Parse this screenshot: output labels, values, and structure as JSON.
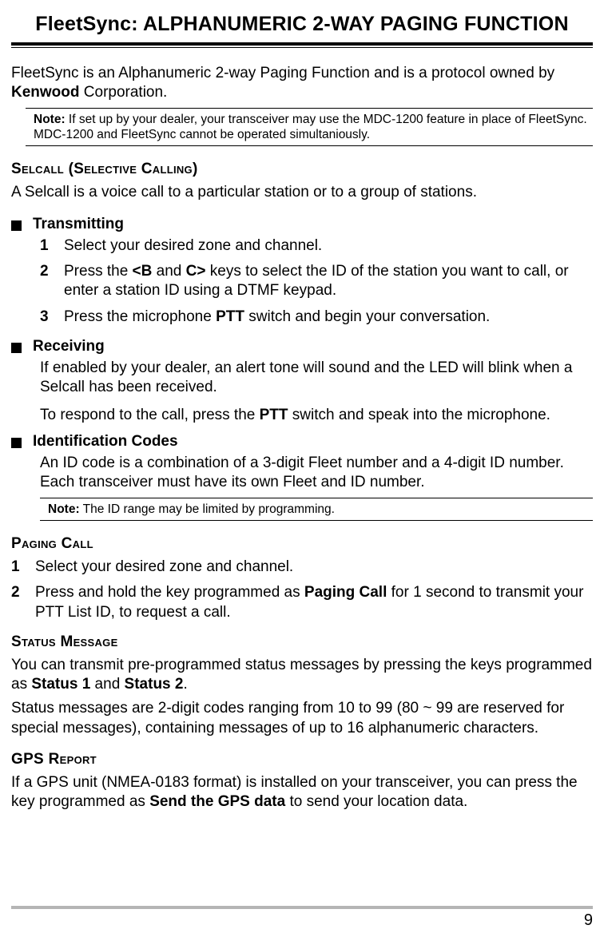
{
  "chapterTitle": "FleetSync: ALPHANUMERIC 2-WAY PAGING FUNCTION",
  "intro": {
    "pre": "FleetSync is an Alphanumeric 2-way Paging Function and is a protocol owned by ",
    "bold": "Kenwood",
    "post": " Corporation."
  },
  "note1": {
    "label": "Note:",
    "text": "  If set up by your dealer, your transceiver may use the MDC-1200 feature in place of FleetSync.  MDC-1200 and FleetSync cannot be operated simultaniously."
  },
  "selcall": {
    "title": "Selcall (Selective Calling)",
    "intro": "A Selcall is a voice call to a particular station or to a group of stations.",
    "transmitting": {
      "label": "Transmitting",
      "steps": {
        "s1": "Select your desired zone and channel.",
        "s2a": "Press the ",
        "s2b1": "<B",
        "s2mid": " and ",
        "s2b2": "C>",
        "s2c": " keys to select the ID of the station you want to call, or enter a station ID using a DTMF keypad.",
        "s3a": "Press the microphone ",
        "s3b": "PTT",
        "s3c": " switch and begin your conversation."
      }
    },
    "receiving": {
      "label": "Receiving",
      "p1": "If enabled by your dealer, an alert tone will sound and the LED will blink when a Selcall has been received.",
      "p2a": "To respond to the call, press the ",
      "p2b": "PTT",
      "p2c": " switch and speak into the microphone."
    },
    "idcodes": {
      "label": "Identification Codes",
      "p": "An ID code is a combination of a 3-digit Fleet number and a 4-digit ID number. Each transceiver must have its own Fleet and ID number."
    },
    "note2": {
      "label": "Note:",
      "text": "  The ID range may be limited by programming."
    }
  },
  "paging": {
    "title": "Paging Call",
    "s1": "Select your desired zone and channel.",
    "s2a": "Press and hold the key programmed as ",
    "s2b": "Paging Call",
    "s2c": " for 1 second to transmit your PTT List ID, to request a call."
  },
  "status": {
    "title": "Status Message",
    "p1a": "You can transmit pre-programmed status messages by pressing the keys programmed as ",
    "p1b1": "Status 1",
    "p1mid": " and ",
    "p1b2": "Status 2",
    "p1c": ".",
    "p2": "Status messages are 2-digit codes ranging from 10 to 99 (80 ~ 99 are reserved for special messages), containing messages of up to 16 alphanumeric characters."
  },
  "gps": {
    "title": "GPS Report",
    "p1a": "If a GPS unit (NMEA-0183 format) is installed on your transceiver, you can press the key programmed as ",
    "p1b": "Send the GPS data",
    "p1c": " to send your location data."
  },
  "pageNumber": "9"
}
